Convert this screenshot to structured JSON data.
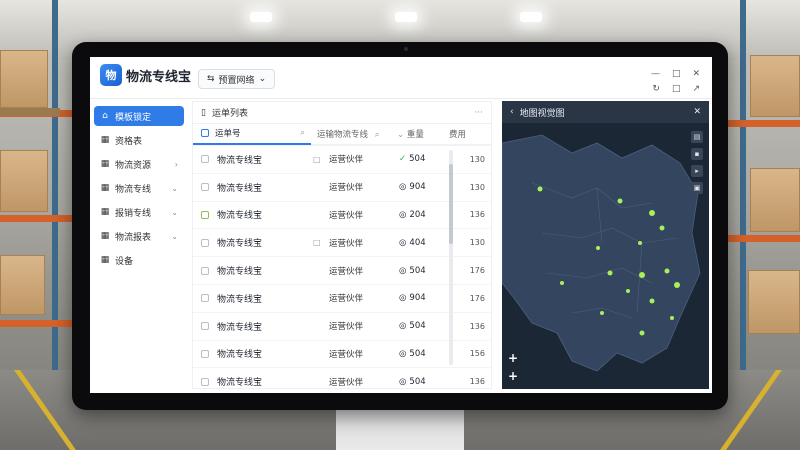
{
  "app": {
    "logo_glyph": "物",
    "title": "物流专线宝",
    "mode_label": "预置网络",
    "accent": "#2f7be8",
    "window_controls": [
      "—",
      "□",
      "✕"
    ],
    "tools": [
      "↻",
      "□",
      "↗"
    ]
  },
  "sidebar": {
    "items": [
      {
        "label": "模板锁定",
        "icon": "home-icon",
        "glyph": "⌂",
        "active": true,
        "chevron": false
      },
      {
        "label": "资格表",
        "icon": "grid-icon",
        "glyph": "▦",
        "active": false,
        "chevron": false
      },
      {
        "label": "物流资源",
        "icon": "grid-icon",
        "glyph": "▦",
        "active": false,
        "chevron": true
      },
      {
        "label": "物流专线",
        "icon": "grid-icon",
        "glyph": "▦",
        "active": false,
        "chevron": true
      },
      {
        "label": "报销专线",
        "icon": "grid-icon",
        "glyph": "▦",
        "active": false,
        "chevron": true
      },
      {
        "label": "物流报表",
        "icon": "grid-icon",
        "glyph": "▦",
        "active": false,
        "chevron": true
      },
      {
        "label": "设备",
        "icon": "grid-icon",
        "glyph": "▦",
        "active": false,
        "chevron": false
      }
    ]
  },
  "table": {
    "title": "运单列表",
    "more": "···",
    "columns": {
      "c1": "运单号",
      "c2": "运输物流专线",
      "c3": "重量",
      "c4": "费用"
    },
    "rows": [
      {
        "name": "物流专线宝",
        "mark": "□",
        "status": "运营伙伴",
        "icon": "✓",
        "num": "504",
        "val": "130"
      },
      {
        "name": "物流专线宝",
        "mark": "",
        "status": "运营伙伴",
        "icon": "◎",
        "num": "904",
        "val": "130"
      },
      {
        "name": "物流专线宝",
        "mark": "",
        "status": "运营伙伴",
        "icon": "◎",
        "num": "204",
        "val": "136"
      },
      {
        "name": "物流专线宝",
        "mark": "□",
        "status": "运营伙伴",
        "icon": "◎",
        "num": "404",
        "val": "130"
      },
      {
        "name": "物流专线宝",
        "mark": "",
        "status": "运营伙伴",
        "icon": "◎",
        "num": "504",
        "val": "176"
      },
      {
        "name": "物流专线宝",
        "mark": "",
        "status": "运营伙伴",
        "icon": "◎",
        "num": "904",
        "val": "176"
      },
      {
        "name": "物流专线宝",
        "mark": "",
        "status": "运营伙伴",
        "icon": "◎",
        "num": "504",
        "val": "136"
      },
      {
        "name": "物流专线宝",
        "mark": "",
        "status": "运营伙伴",
        "icon": "◎",
        "num": "504",
        "val": "156"
      },
      {
        "name": "物流专线宝",
        "mark": "",
        "status": "运营伙伴",
        "icon": "◎",
        "num": "504",
        "val": "136"
      }
    ]
  },
  "map": {
    "title": "地图视觉图",
    "back": "‹",
    "close": "✕",
    "tools": [
      "▤",
      "▪",
      "▸",
      "▣"
    ],
    "zoom_in": "+",
    "zoom_out": "+",
    "land_color": "#34465f",
    "water_color": "#1c2736",
    "dot_color": "#a8f05a"
  }
}
